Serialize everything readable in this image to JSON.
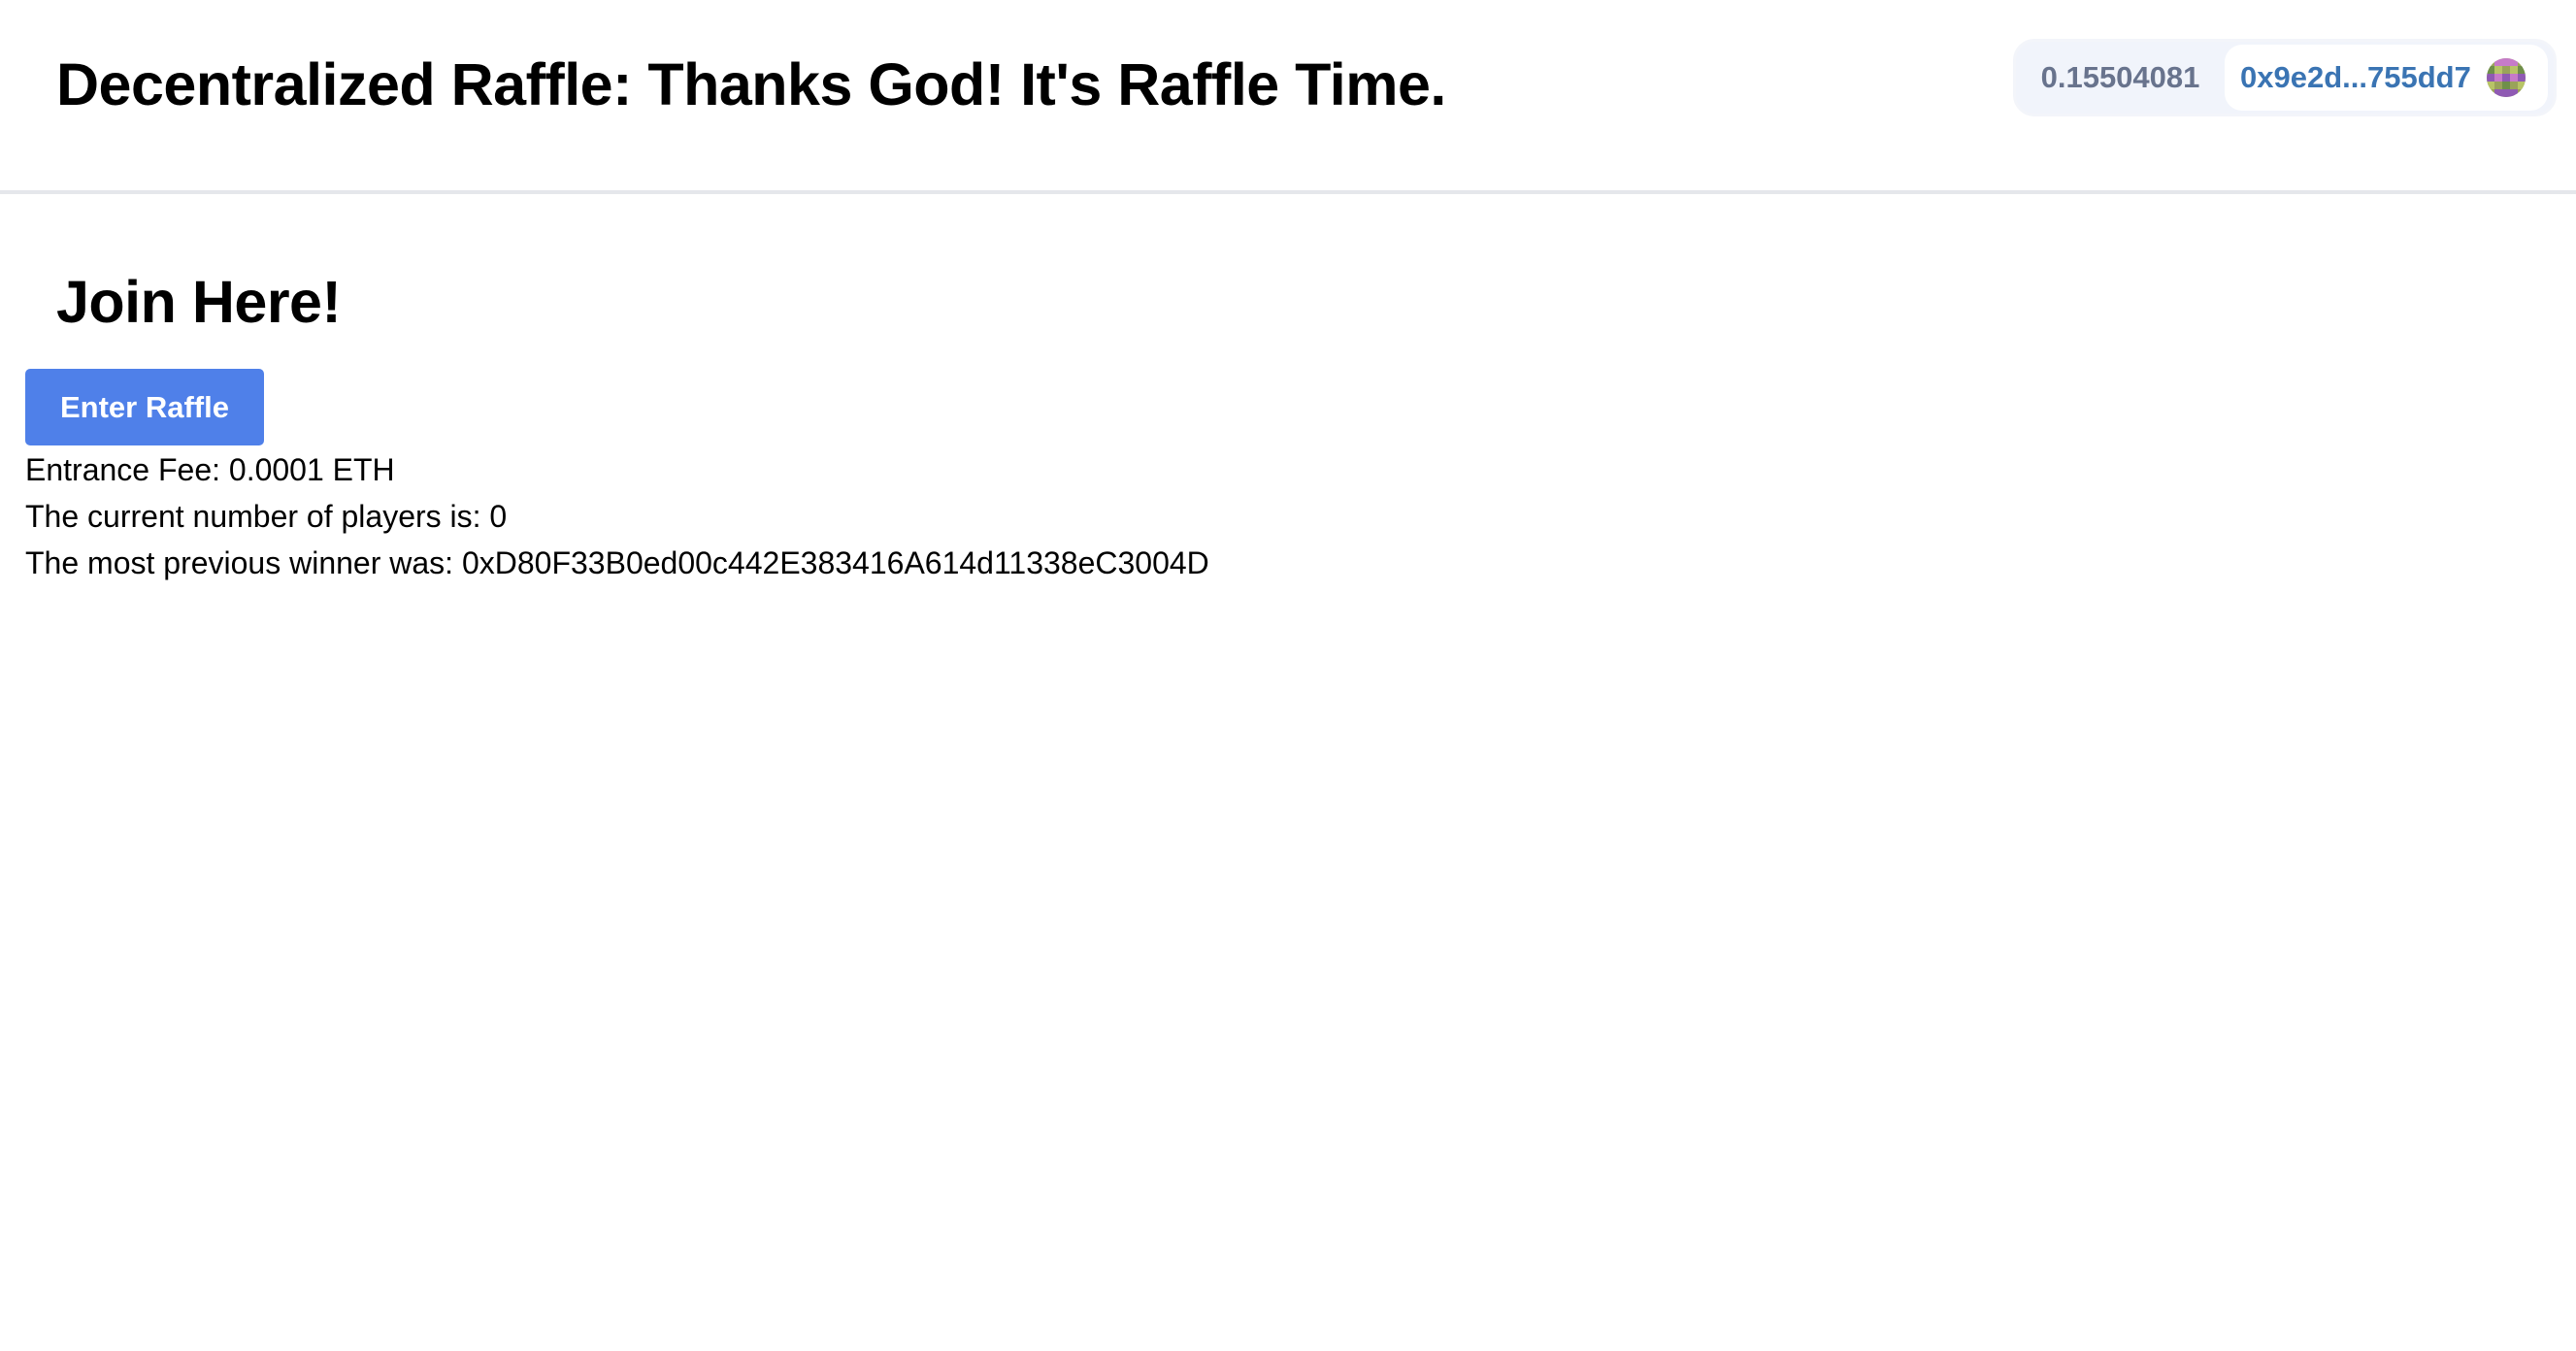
{
  "header": {
    "title": "Decentralized Raffle: Thanks God! It's Raffle Time."
  },
  "wallet": {
    "balance": "0.15504081",
    "address": "0x9e2d...755dd7",
    "avatar_icon": "wallet-avatar-icon"
  },
  "main": {
    "heading": "Join Here!",
    "enter_button_label": "Enter Raffle",
    "entrance_fee_text": "Entrance Fee: 0.0001 ETH",
    "players_text": "The current number of players is: 0",
    "winner_text": "The most previous winner was: 0xD80F33B0ed00c442E383416A614d11338eC3004D"
  },
  "colors": {
    "button": "#4f80e9",
    "wallet_bg": "#f1f4fb",
    "address": "#3a74b3",
    "balance": "#68738d",
    "divider": "#e5e7eb"
  }
}
